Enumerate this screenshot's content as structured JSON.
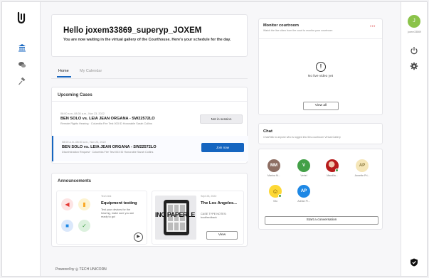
{
  "user": {
    "initial": "J",
    "name": "joxem33869"
  },
  "welcome": {
    "title": "Hello joxem33869_superyp_JOXEM",
    "subtitle": "You are now waiting in the virtual gallery of the Courthouse. Here's your schedule for the day."
  },
  "tabs": [
    {
      "label": "Home"
    },
    {
      "label": "My Calendar"
    }
  ],
  "upcoming": {
    "title": "Upcoming Cases",
    "cases": [
      {
        "meta": "08:00 a.m.-08:30 a.m., Nov 23, 2022",
        "name": "BEN SOLO vs. LEIA JEAN ORGANA - SW22572LO",
        "detail": "Remote Rights Hearing  ·  Columbia Fire Test 003 ID Honorable Sarah Collins",
        "button": "Not in session"
      },
      {
        "meta": "08:00 a.m.-08:30 a.m., Nov 23, 2022",
        "name": "BEN SOLO vs. LEIA JEAN ORGANA - SW22572LO",
        "detail": "Discrimination Request  ·  Columbia Fire Test 003 ID Honorable Sarah Collins",
        "button": "Join now"
      }
    ]
  },
  "announcements": {
    "title": "Announcements",
    "items": [
      {
        "label": "Tech test",
        "title": "Equipment testing",
        "body": "Test your devices for the hearing, make sure you are ready to go!"
      },
      {
        "label": "Sept 28, 2022",
        "title": "The Los Angeles...",
        "body": "CASE TYPE NOTES: bootfeedback",
        "image_text": "ING PAPERLE",
        "button": "View"
      }
    ]
  },
  "footer": {
    "text": "Powered by ◎ TECH UNICORN"
  },
  "monitor": {
    "title": "Monitor courtroom",
    "subtitle": "Watch the live video from the court to monitor your courtroom",
    "menu": "•••",
    "empty_icon": "!",
    "empty_text": "No live video yet",
    "button": "View all"
  },
  "chat": {
    "title": "Chat",
    "subtitle": "Chat/Talk to anyone who is logged into this courtroom Virtual Gallery"
  },
  "participants": {
    "people": [
      {
        "initials": "MM",
        "name": "Marina M...",
        "color": "#8d6e63"
      },
      {
        "initials": "V",
        "name": "Vertel",
        "color": "#43a047"
      },
      {
        "initials": "",
        "name": "Mandila...",
        "color": "#b71c1c"
      },
      {
        "initials": "AP",
        "name": "Annette Pri...",
        "color": "#f5e6b8"
      },
      {
        "initials": "",
        "name": "Vito",
        "color": "#fdd835"
      },
      {
        "initials": "AP",
        "name": "Adrian Pi...",
        "color": "#1e88e5"
      }
    ],
    "button": "Start a conversation"
  }
}
